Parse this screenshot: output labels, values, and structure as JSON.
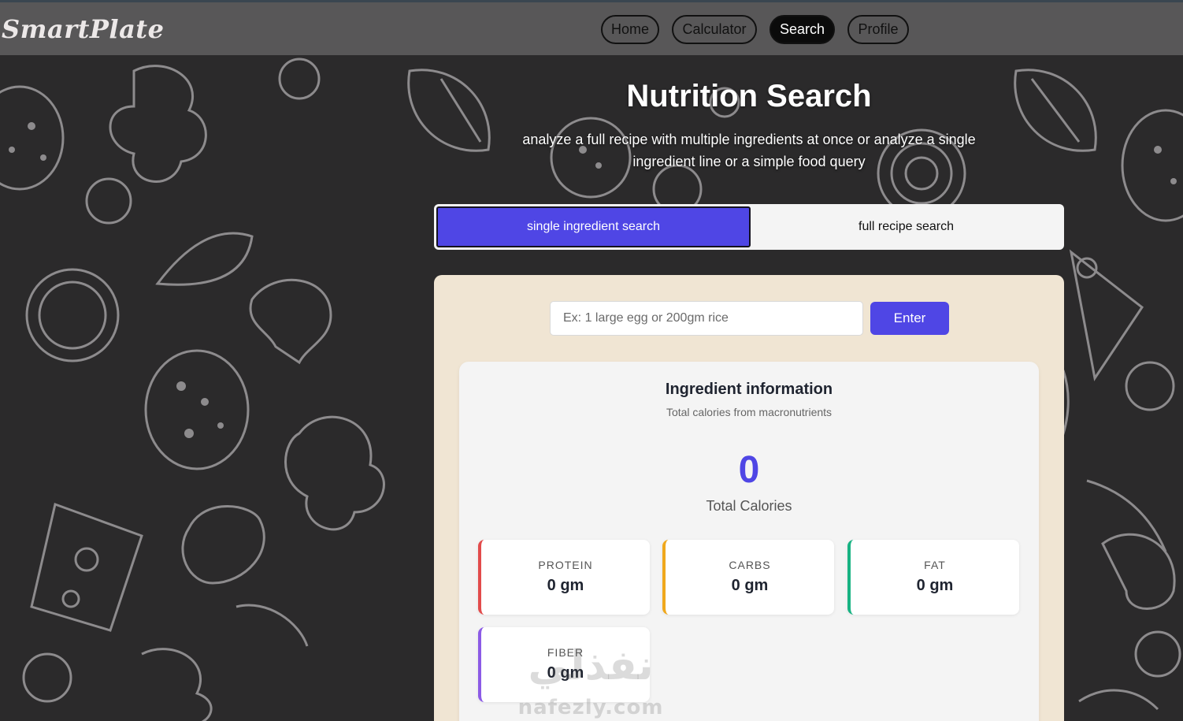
{
  "app": {
    "logo": "SmartPlate"
  },
  "nav": {
    "items": [
      {
        "label": "Home",
        "active": false
      },
      {
        "label": "Calculator",
        "active": false
      },
      {
        "label": "Search",
        "active": true
      },
      {
        "label": "Profile",
        "active": false
      }
    ]
  },
  "hero": {
    "title": "Nutrition Search",
    "subtitle": "analyze a full recipe with multiple ingredients at once or analyze a single ingredient line or a simple food query"
  },
  "tabs": [
    {
      "label": "single ingredient search",
      "active": true
    },
    {
      "label": "full recipe search",
      "active": false
    }
  ],
  "search": {
    "placeholder": "Ex: 1 large egg or 200gm rice",
    "value": "",
    "button_label": "Enter"
  },
  "info": {
    "title": "Ingredient information",
    "subtitle": "Total calories from macronutrients",
    "total_calories": "0",
    "total_label": "Total Calories",
    "macros": [
      {
        "label": "PROTEIN",
        "value": "0 gm",
        "color": "#e24b4b"
      },
      {
        "label": "CARBS",
        "value": "0 gm",
        "color": "#f0a81c"
      },
      {
        "label": "FAT",
        "value": "0 gm",
        "color": "#18b383"
      },
      {
        "label": "FIBER",
        "value": "0 gm",
        "color": "#8c5be6"
      }
    ]
  },
  "watermark": {
    "main": "نفذلي",
    "sub": "nafezly.com"
  },
  "colors": {
    "accent": "#4f46e5",
    "background": "#2b2a2b",
    "navbar": "#585758",
    "panel": "#f0e5d3",
    "card": "#f4f4f4",
    "doodle": "#8d8b8d"
  }
}
